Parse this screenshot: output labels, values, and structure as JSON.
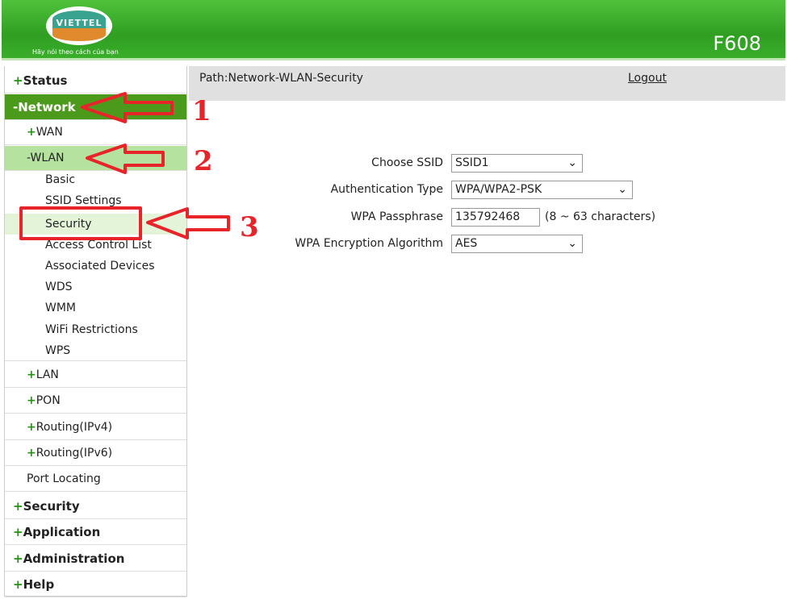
{
  "header": {
    "logo": "VIETTEL",
    "slogan": "Hãy nói theo cách của bạn",
    "model": "F608"
  },
  "sidebar": {
    "status": "Status",
    "network": "-Network",
    "wan": "WAN",
    "wlan": "-WLAN",
    "wlan_items": [
      "Basic",
      "SSID Settings",
      "Security",
      "Access Control List",
      "Associated Devices",
      "WDS",
      "WMM",
      "WiFi Restrictions",
      "WPS"
    ],
    "lan": "LAN",
    "pon": "PON",
    "routing4": "Routing(IPv4)",
    "routing6": "Routing(IPv6)",
    "port": "Port Locating",
    "security": "Security",
    "application": "Application",
    "administration": "Administration",
    "help": "Help",
    "plus": "+"
  },
  "main": {
    "path": "Path:Network-WLAN-Security",
    "logout": "Logout",
    "form": {
      "ssid_label": "Choose SSID",
      "ssid_value": "SSID1",
      "auth_label": "Authentication Type",
      "auth_value": "WPA/WPA2-PSK",
      "pass_label": "WPA Passphrase",
      "pass_value": "135792468",
      "pass_hint": "(8 ~ 63 characters)",
      "enc_label": "WPA Encryption Algorithm",
      "enc_value": "AES"
    }
  },
  "annotations": {
    "n1": "1",
    "n2": "2",
    "n3": "3",
    "color": "#e8242b"
  },
  "colors": {
    "brand": "#2f9e22",
    "network_active": "#4c9a1c",
    "wlan_active": "#b6e29f"
  }
}
